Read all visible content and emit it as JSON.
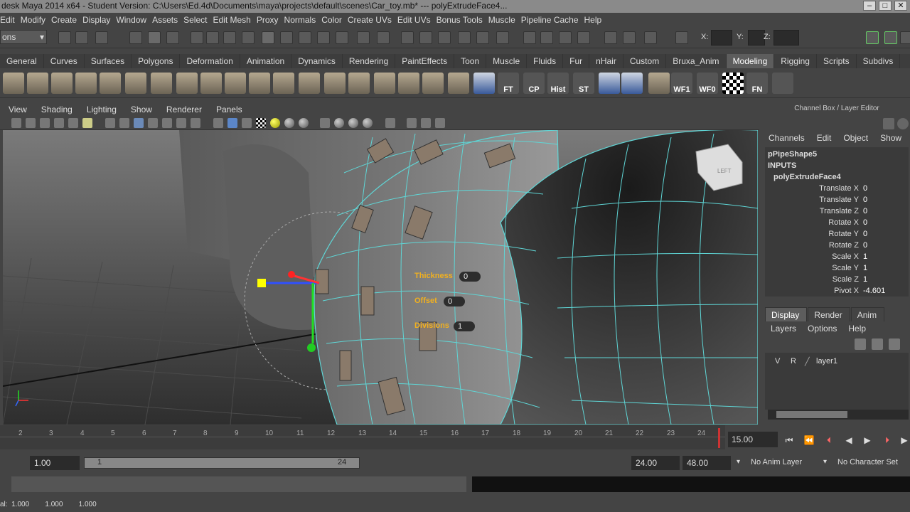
{
  "title": {
    "text": "desk Maya 2014 x64 - Student Version: C:\\Users\\Ed.4d\\Documents\\maya\\projects\\default\\scenes\\Car_toy.mb*   ---   polyExtrudeFace4..."
  },
  "menu": {
    "items": [
      "Edit",
      "Modify",
      "Create",
      "Display",
      "Window",
      "Assets",
      "Select",
      "Edit Mesh",
      "Proxy",
      "Normals",
      "Color",
      "Create UVs",
      "Edit UVs",
      "Bonus Tools",
      "Muscle",
      "Pipeline Cache",
      "Help"
    ]
  },
  "status_line": {
    "mode_select": "ons",
    "x_label": "X:",
    "y_label": "Y:",
    "z_label": "Z:"
  },
  "shelf": {
    "tabs": [
      "General",
      "Curves",
      "Surfaces",
      "Polygons",
      "Deformation",
      "Animation",
      "Dynamics",
      "Rendering",
      "PaintEffects",
      "Toon",
      "Muscle",
      "Fluids",
      "Fur",
      "nHair",
      "Custom",
      "Bruxa_Anim",
      "Modeling",
      "Rigging",
      "Scripts",
      "Subdivs"
    ],
    "active_tab": "Modeling",
    "icon_labels": [
      "FT",
      "CP",
      "Hist",
      "ST",
      "WF1",
      "WF0",
      "FN"
    ]
  },
  "viewport": {
    "menu": [
      "View",
      "Shading",
      "Lighting",
      "Show",
      "Renderer",
      "Panels"
    ],
    "hud": [
      {
        "label": "Thickness",
        "value": "0"
      },
      {
        "label": "Offset",
        "value": "0"
      },
      {
        "label": "Divisions",
        "value": "1"
      }
    ],
    "view_cube_label": "LEFT"
  },
  "channel_box": {
    "header": "Channel Box / Layer Editor",
    "menu": [
      "Channels",
      "Edit",
      "Object",
      "Show"
    ],
    "shape": "pPipeShape5",
    "inputs_label": "INPUTS",
    "node": "polyExtrudeFace4",
    "attributes": [
      {
        "name": "Translate X",
        "value": "0"
      },
      {
        "name": "Translate Y",
        "value": "0"
      },
      {
        "name": "Translate Z",
        "value": "0"
      },
      {
        "name": "Rotate X",
        "value": "0"
      },
      {
        "name": "Rotate Y",
        "value": "0"
      },
      {
        "name": "Rotate Z",
        "value": "0"
      },
      {
        "name": "Scale X",
        "value": "1"
      },
      {
        "name": "Scale Y",
        "value": "1"
      },
      {
        "name": "Scale Z",
        "value": "1"
      },
      {
        "name": "Pivot X",
        "value": "-4.601"
      }
    ]
  },
  "layer_editor": {
    "tabs": [
      "Display",
      "Render",
      "Anim"
    ],
    "active_tab": "Display",
    "menu": [
      "Layers",
      "Options",
      "Help"
    ],
    "layer": {
      "v": "V",
      "r": "R",
      "name": "layer1"
    }
  },
  "timeline": {
    "ticks": [
      "2",
      "3",
      "4",
      "5",
      "6",
      "7",
      "8",
      "9",
      "10",
      "11",
      "12",
      "13",
      "14",
      "15",
      "16",
      "17",
      "18",
      "19",
      "20",
      "21",
      "22",
      "23",
      "24"
    ],
    "current_frame": "15.00"
  },
  "range": {
    "start": "1.00",
    "slider_start": "1",
    "slider_end": "24",
    "end": "24.00",
    "anim_end": "48.00",
    "anim_layer": "No Anim Layer",
    "character_set": "No Character Set"
  },
  "help_line": {
    "text": "al:  1.000        1.000        1.000"
  },
  "colors": {
    "accent": "#f0b020",
    "wire": "#5fd6d6",
    "active_tab": "#5d5d5d"
  }
}
